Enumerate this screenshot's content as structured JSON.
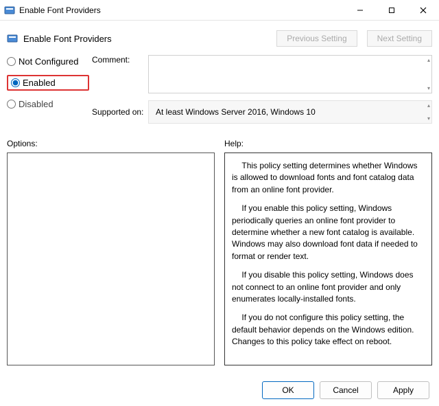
{
  "window": {
    "title": "Enable Font Providers"
  },
  "header": {
    "title": "Enable Font Providers",
    "prev_label": "Previous Setting",
    "next_label": "Next Setting"
  },
  "state": {
    "not_configured": "Not Configured",
    "enabled": "Enabled",
    "disabled": "Disabled",
    "selected": "enabled"
  },
  "labels": {
    "comment": "Comment:",
    "supported_on": "Supported on:",
    "options": "Options:",
    "help": "Help:"
  },
  "comment_value": "",
  "supported_on_value": "At least Windows Server 2016, Windows 10",
  "help_paragraphs": {
    "p1": "This policy setting determines whether Windows is allowed to download fonts and font catalog data from an online font provider.",
    "p2": "If you enable this policy setting, Windows periodically queries an online font provider to determine whether a new font catalog is available. Windows may also download font data if needed to format or render text.",
    "p3": "If you disable this policy setting, Windows does not connect to an online font provider and only enumerates locally-installed fonts.",
    "p4": "If you do not configure this policy setting, the default behavior depends on the Windows edition. Changes to this policy take effect on reboot."
  },
  "buttons": {
    "ok": "OK",
    "cancel": "Cancel",
    "apply": "Apply"
  }
}
